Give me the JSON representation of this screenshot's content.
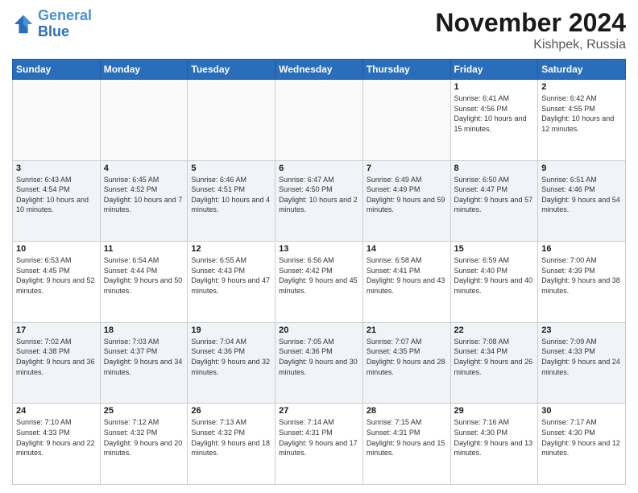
{
  "logo": {
    "line1": "General",
    "line2": "Blue"
  },
  "header": {
    "month": "November 2024",
    "location": "Kishpek, Russia"
  },
  "weekdays": [
    "Sunday",
    "Monday",
    "Tuesday",
    "Wednesday",
    "Thursday",
    "Friday",
    "Saturday"
  ],
  "weeks": [
    [
      {
        "day": "",
        "info": ""
      },
      {
        "day": "",
        "info": ""
      },
      {
        "day": "",
        "info": ""
      },
      {
        "day": "",
        "info": ""
      },
      {
        "day": "",
        "info": ""
      },
      {
        "day": "1",
        "info": "Sunrise: 6:41 AM\nSunset: 4:56 PM\nDaylight: 10 hours and 15 minutes."
      },
      {
        "day": "2",
        "info": "Sunrise: 6:42 AM\nSunset: 4:55 PM\nDaylight: 10 hours and 12 minutes."
      }
    ],
    [
      {
        "day": "3",
        "info": "Sunrise: 6:43 AM\nSunset: 4:54 PM\nDaylight: 10 hours and 10 minutes."
      },
      {
        "day": "4",
        "info": "Sunrise: 6:45 AM\nSunset: 4:52 PM\nDaylight: 10 hours and 7 minutes."
      },
      {
        "day": "5",
        "info": "Sunrise: 6:46 AM\nSunset: 4:51 PM\nDaylight: 10 hours and 4 minutes."
      },
      {
        "day": "6",
        "info": "Sunrise: 6:47 AM\nSunset: 4:50 PM\nDaylight: 10 hours and 2 minutes."
      },
      {
        "day": "7",
        "info": "Sunrise: 6:49 AM\nSunset: 4:49 PM\nDaylight: 9 hours and 59 minutes."
      },
      {
        "day": "8",
        "info": "Sunrise: 6:50 AM\nSunset: 4:47 PM\nDaylight: 9 hours and 57 minutes."
      },
      {
        "day": "9",
        "info": "Sunrise: 6:51 AM\nSunset: 4:46 PM\nDaylight: 9 hours and 54 minutes."
      }
    ],
    [
      {
        "day": "10",
        "info": "Sunrise: 6:53 AM\nSunset: 4:45 PM\nDaylight: 9 hours and 52 minutes."
      },
      {
        "day": "11",
        "info": "Sunrise: 6:54 AM\nSunset: 4:44 PM\nDaylight: 9 hours and 50 minutes."
      },
      {
        "day": "12",
        "info": "Sunrise: 6:55 AM\nSunset: 4:43 PM\nDaylight: 9 hours and 47 minutes."
      },
      {
        "day": "13",
        "info": "Sunrise: 6:56 AM\nSunset: 4:42 PM\nDaylight: 9 hours and 45 minutes."
      },
      {
        "day": "14",
        "info": "Sunrise: 6:58 AM\nSunset: 4:41 PM\nDaylight: 9 hours and 43 minutes."
      },
      {
        "day": "15",
        "info": "Sunrise: 6:59 AM\nSunset: 4:40 PM\nDaylight: 9 hours and 40 minutes."
      },
      {
        "day": "16",
        "info": "Sunrise: 7:00 AM\nSunset: 4:39 PM\nDaylight: 9 hours and 38 minutes."
      }
    ],
    [
      {
        "day": "17",
        "info": "Sunrise: 7:02 AM\nSunset: 4:38 PM\nDaylight: 9 hours and 36 minutes."
      },
      {
        "day": "18",
        "info": "Sunrise: 7:03 AM\nSunset: 4:37 PM\nDaylight: 9 hours and 34 minutes."
      },
      {
        "day": "19",
        "info": "Sunrise: 7:04 AM\nSunset: 4:36 PM\nDaylight: 9 hours and 32 minutes."
      },
      {
        "day": "20",
        "info": "Sunrise: 7:05 AM\nSunset: 4:36 PM\nDaylight: 9 hours and 30 minutes."
      },
      {
        "day": "21",
        "info": "Sunrise: 7:07 AM\nSunset: 4:35 PM\nDaylight: 9 hours and 28 minutes."
      },
      {
        "day": "22",
        "info": "Sunrise: 7:08 AM\nSunset: 4:34 PM\nDaylight: 9 hours and 26 minutes."
      },
      {
        "day": "23",
        "info": "Sunrise: 7:09 AM\nSunset: 4:33 PM\nDaylight: 9 hours and 24 minutes."
      }
    ],
    [
      {
        "day": "24",
        "info": "Sunrise: 7:10 AM\nSunset: 4:33 PM\nDaylight: 9 hours and 22 minutes."
      },
      {
        "day": "25",
        "info": "Sunrise: 7:12 AM\nSunset: 4:32 PM\nDaylight: 9 hours and 20 minutes."
      },
      {
        "day": "26",
        "info": "Sunrise: 7:13 AM\nSunset: 4:32 PM\nDaylight: 9 hours and 18 minutes."
      },
      {
        "day": "27",
        "info": "Sunrise: 7:14 AM\nSunset: 4:31 PM\nDaylight: 9 hours and 17 minutes."
      },
      {
        "day": "28",
        "info": "Sunrise: 7:15 AM\nSunset: 4:31 PM\nDaylight: 9 hours and 15 minutes."
      },
      {
        "day": "29",
        "info": "Sunrise: 7:16 AM\nSunset: 4:30 PM\nDaylight: 9 hours and 13 minutes."
      },
      {
        "day": "30",
        "info": "Sunrise: 7:17 AM\nSunset: 4:30 PM\nDaylight: 9 hours and 12 minutes."
      }
    ]
  ]
}
